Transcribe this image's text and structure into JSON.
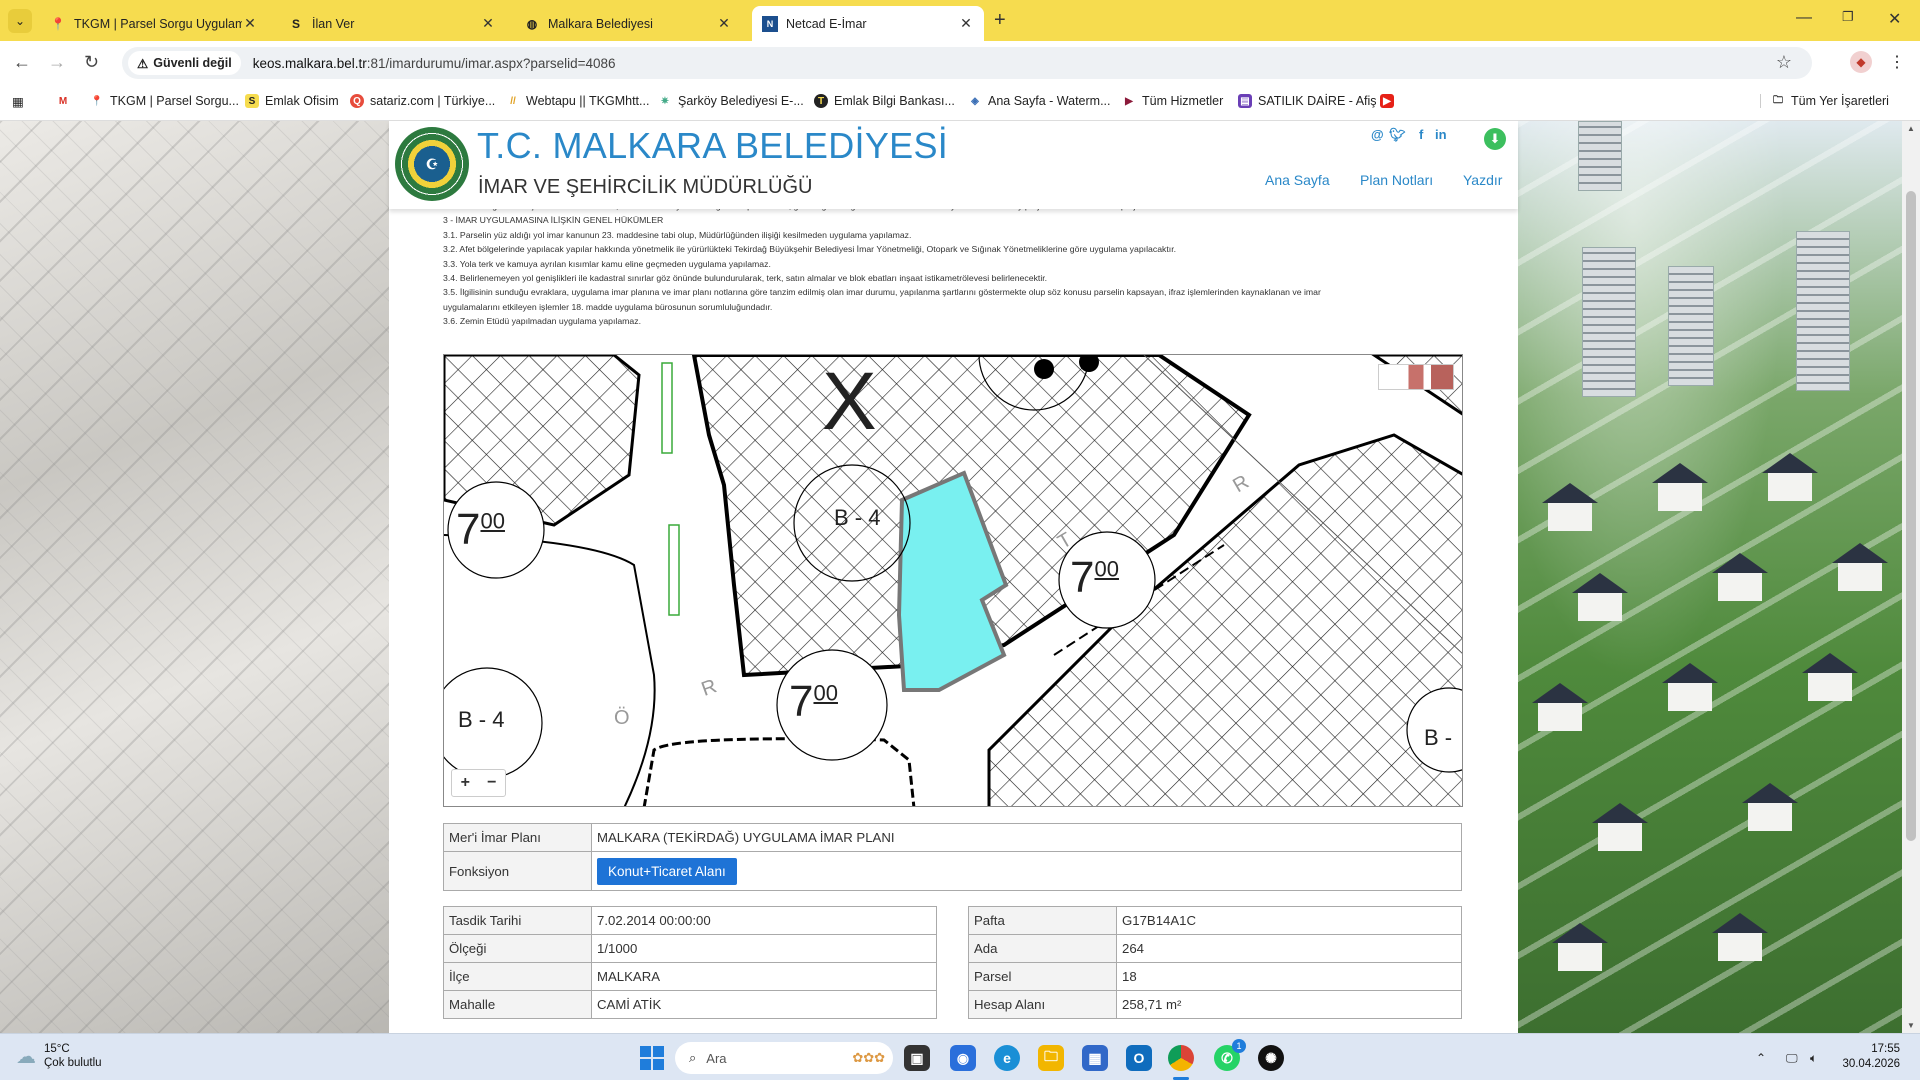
{
  "browser": {
    "tabs": [
      {
        "title": "TKGM | Parsel Sorgu Uygulama",
        "icon": "map-pin-icon",
        "active": false
      },
      {
        "title": "İlan Ver",
        "icon": "sahibinden-s-icon",
        "active": false
      },
      {
        "title": "Malkara Belediyesi",
        "icon": "globe-icon",
        "active": false
      },
      {
        "title": "Netcad E-İmar",
        "icon": "netcad-icon",
        "active": true
      }
    ],
    "security_label": "Güvenli değil",
    "url_host": "keos.malkara.bel.tr",
    "url_path": ":81/imardurumu/imar.aspx?parselid=4086",
    "bookmarks": [
      {
        "label": "",
        "icon": "gmail-icon"
      },
      {
        "label": "TKGM | Parsel Sorgu...",
        "icon": "map-pin-icon"
      },
      {
        "label": "Emlak Ofisim",
        "icon": "sahibinden-s-icon"
      },
      {
        "label": "satariz.com | Türkiye...",
        "icon": "satariz-icon"
      },
      {
        "label": "Webtapu || TKGMhtt...",
        "icon": "webtapu-icon"
      },
      {
        "label": "Şarköy Belediyesi E-...",
        "icon": "sarkoy-icon"
      },
      {
        "label": "Emlak Bilgi Bankası...",
        "icon": "emlak-t-icon"
      },
      {
        "label": "Ana Sayfa - Waterm...",
        "icon": "watermark-icon"
      },
      {
        "label": "Tüm Hizmetler",
        "icon": "hizmetler-icon"
      },
      {
        "label": "SATILIK DAİRE - Afiş",
        "icon": "afis-icon"
      },
      {
        "label": "",
        "icon": "youtube-icon"
      }
    ],
    "all_bookmarks_label": "Tüm Yer İşaretleri"
  },
  "page": {
    "title": "T.C. MALKARA BELEDİYESİ",
    "subtitle": "İMAR VE ŞEHİRCİLİK MÜDÜRLÜĞÜ",
    "nav": [
      "Ana Sayfa",
      "Plan Notları",
      "Yazdır"
    ],
    "notes": [
      "mesafelerini gösterir inşaat istikamet rölevesi, tabii zemin ve yol kotları gösterir plan kotesi, gerekli görüldüğü takdirde muhtelif en-boy kesitleri ve detay projeleri mimari ve statik projelere eklenecektir.",
      "3 - İMAR UYGULAMASINA İLİŞKİN GENEL HÜKÜMLER",
      "3.1. Parselin yüz aldığı yol imar kanunun 23. maddesine tabi olup, Müdürlüğünden ilişiği kesilmeden uygulama yapılamaz.",
      "3.2. Afet bölgelerinde yapılacak yapılar hakkında yönetmelik ile yürürlükteki Tekirdağ Büyükşehir Belediyesi İmar Yönetmeliği, Otopark ve Sığınak Yönetmeliklerine göre uygulama yapılacaktır.",
      "3.3. Yola terk ve kamuya ayrılan kısımlar kamu eline geçmeden uygulama yapılamaz.",
      "3.4. Belirlenemeyen yol genişlikleri ile kadastral sınırlar göz önünde bulundurularak, terk, satın almalar ve blok ebatları inşaat istikametrölevesi belirlenecektir.",
      "3.5. İlgilisinin sunduğu evraklara, uygulama imar planına ve imar planı notlarına göre tanzim edilmiş olan imar durumu, yapılanma şartlarını göstermekte olup söz konusu parselin kapsayan, ifraz işlemlerinden kaynaklanan ve imar",
      "uygulamalarını etkileyen işlemler 18. madde uygulama bürosunun sorumluluğundadır.",
      "3.6. Zemin Etüdü yapılmadan uygulama yapılamaz."
    ],
    "map": {
      "labels": {
        "x_mark": "X",
        "b4_top": "B - 4",
        "b4_left": "B - 4",
        "b4_right": "B -",
        "h700": "7",
        "h700_sup": "00",
        "road_r1": "R",
        "road_r2": "R",
        "road_o": "Ö",
        "road_t": "T"
      },
      "parcel_color": "#79f0f0",
      "zoom_in": "+",
      "zoom_out": "−"
    },
    "plan_table": {
      "plan_label": "Mer'i İmar Planı",
      "plan_value": "MALKARA (TEKİRDAĞ) UYGULAMA İMAR PLANI",
      "function_label": "Fonksiyon",
      "function_value": "Konut+Ticaret Alanı"
    },
    "left_table": [
      {
        "label": "Tasdik Tarihi",
        "value": "7.02.2014 00:00:00"
      },
      {
        "label": "Ölçeği",
        "value": "1/1000"
      },
      {
        "label": "İlçe",
        "value": "MALKARA"
      },
      {
        "label": "Mahalle",
        "value": "CAMİ ATİK"
      }
    ],
    "right_table": [
      {
        "label": "Pafta",
        "value": "G17B14A1C"
      },
      {
        "label": "Ada",
        "value": "264"
      },
      {
        "label": "Parsel",
        "value": "18"
      },
      {
        "label": "Hesap Alanı",
        "value": "258,71 m²"
      }
    ]
  },
  "taskbar": {
    "temperature": "15°C",
    "weather": "Çok bulutlu",
    "search_placeholder": "Ara",
    "time": "17:55",
    "date": "30.04.2026",
    "notification_badge": "1"
  }
}
